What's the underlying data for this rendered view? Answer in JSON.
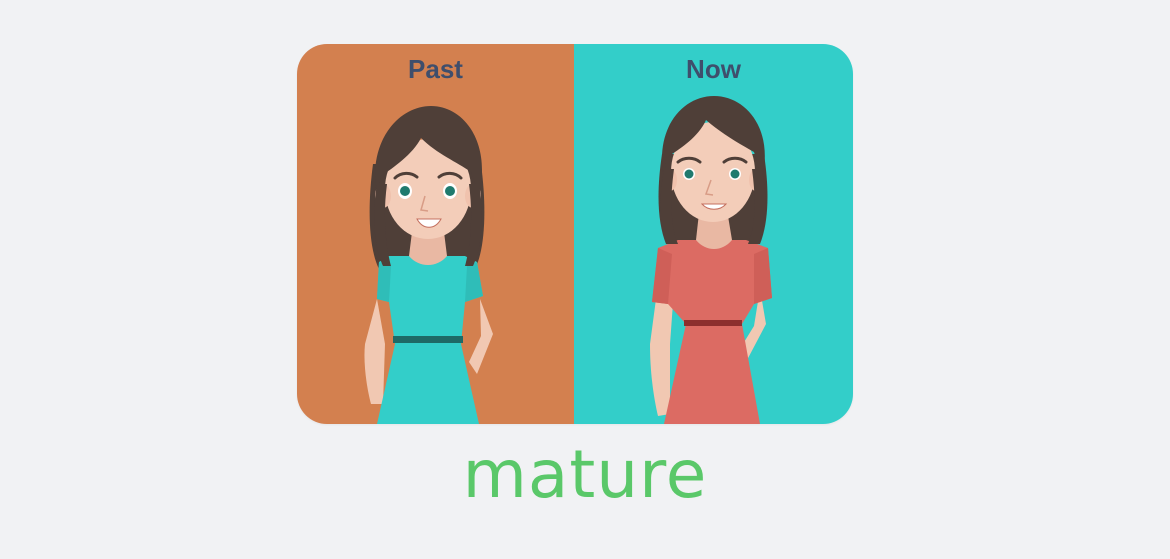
{
  "card": {
    "past_label": "Past",
    "now_label": "Now"
  },
  "word": "mature",
  "colors": {
    "past_background": "#d3804f",
    "now_background": "#33cec9",
    "label_text": "#3f4e6c",
    "word_text": "#5ac869",
    "page_background": "#f1f2f4"
  }
}
